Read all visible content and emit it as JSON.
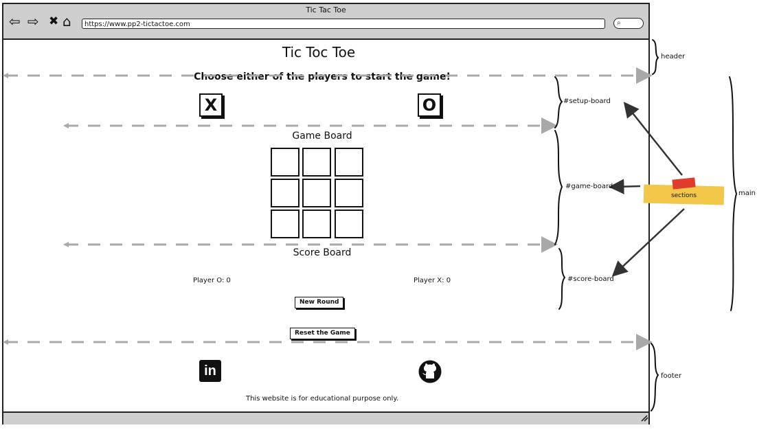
{
  "window": {
    "title": "Tic Tac Toe",
    "url": "https://www.pp2-tictactoe.com"
  },
  "nav_icons": {
    "back": "⇦",
    "forward": "⇨",
    "close": "✖",
    "home": "⌂",
    "search": "⌕"
  },
  "page": {
    "title": "Tic Toc Toe",
    "prompt": "Choose either of the players to start the game!",
    "players": [
      "X",
      "O"
    ],
    "game_board_title": "Game Board",
    "score_board_title": "Score Board",
    "score_o": "Player O: 0",
    "score_x": "Player X: 0",
    "new_round": "New Round",
    "reset_game": "Reset the Game",
    "footer_text": "This website is for educational purpose only."
  },
  "footer_icons": {
    "linkedin": "in",
    "github": "github-icon"
  },
  "annotations": {
    "header": "header",
    "setup_board": "#setup-board",
    "game_board": "#game-board",
    "score_board": "#score-board",
    "sections": "sections",
    "main": "main",
    "footer": "footer"
  },
  "colors": {
    "frame_bar": "#cfcfcf",
    "sticky_note": "#f3c74a",
    "sticky_tape": "#e03b2b",
    "dash_line": "#a8a8a8"
  }
}
